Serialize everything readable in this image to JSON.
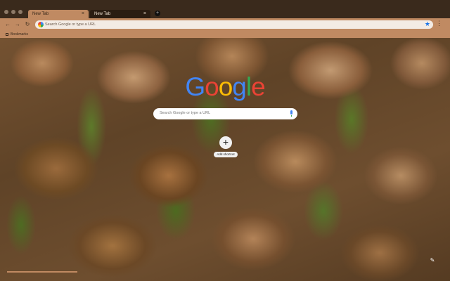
{
  "window": {
    "tabs": [
      {
        "label": "New Tab",
        "active": true
      },
      {
        "label": "New Tab",
        "active": false
      }
    ],
    "new_tab_glyph": "+",
    "tab_close_glyph": "×"
  },
  "toolbar": {
    "back_glyph": "←",
    "forward_glyph": "→",
    "reload_glyph": "↻",
    "omnibox_placeholder": "Search Google or type a URL",
    "star_glyph": "★",
    "menu_glyph": "⋮"
  },
  "bookmarks": {
    "items": [
      {
        "label": "Bookmarks"
      }
    ]
  },
  "main": {
    "logo_letters": [
      {
        "char": "G",
        "color": "#4285f4"
      },
      {
        "char": "o",
        "color": "#ea4335"
      },
      {
        "char": "o",
        "color": "#fbbc05"
      },
      {
        "char": "g",
        "color": "#4285f4"
      },
      {
        "char": "l",
        "color": "#34a853"
      },
      {
        "char": "e",
        "color": "#ea4335"
      }
    ],
    "search_placeholder": "Search Google or type a URL",
    "shortcut": {
      "icon": "+",
      "label": "Add shortcut"
    },
    "customize_glyph": "✎"
  },
  "colors": {
    "chrome_dark": "#3a2a1c",
    "chrome_light": "#c08a62",
    "accent": "#1a73e8"
  }
}
